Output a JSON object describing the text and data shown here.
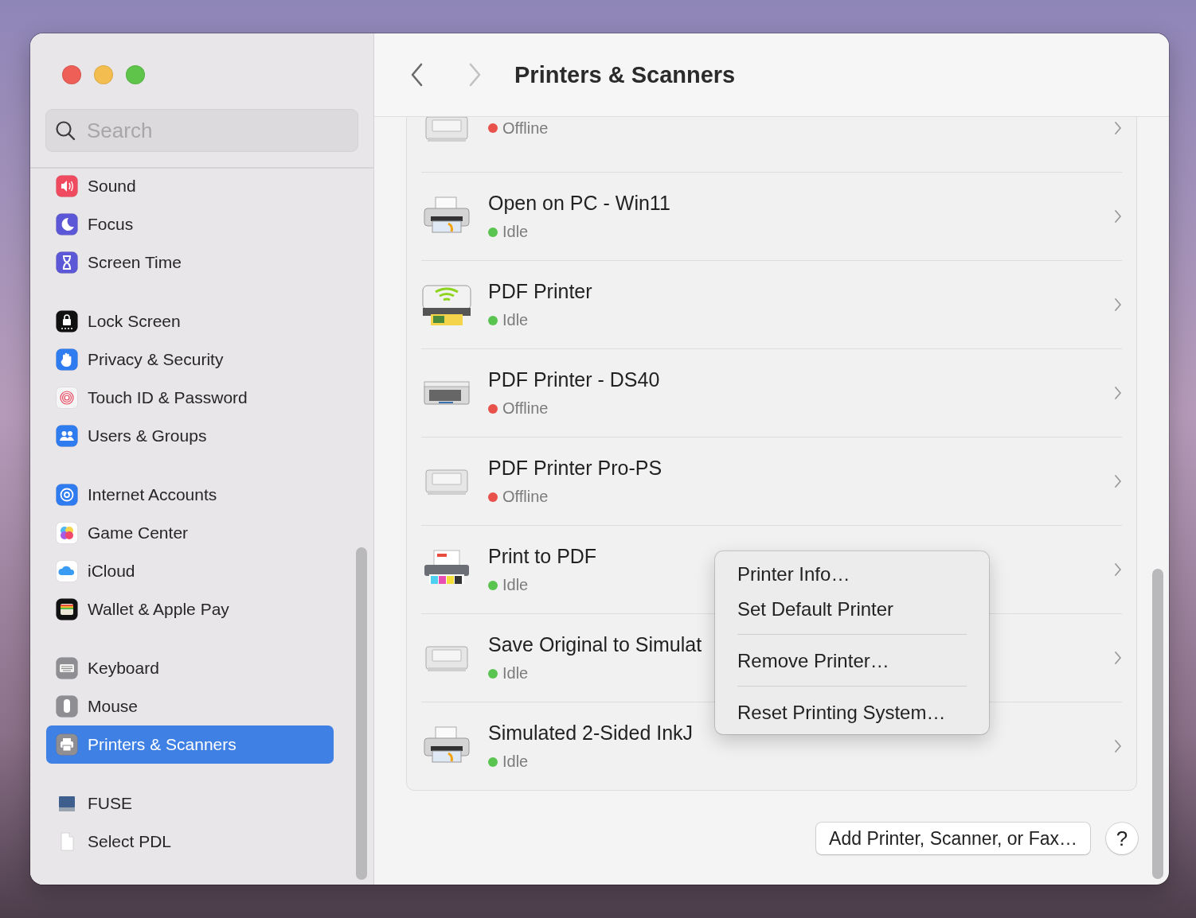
{
  "window": {
    "title": "Printers & Scanners"
  },
  "traffic_lights": [
    {
      "color": "#ed5f57"
    },
    {
      "color": "#f4bd4f"
    },
    {
      "color": "#5ec54a"
    }
  ],
  "search": {
    "placeholder": "Search"
  },
  "sidebar": {
    "groups": [
      [
        {
          "label": "Sound",
          "selected": false
        },
        {
          "label": "Focus",
          "selected": false
        },
        {
          "label": "Screen Time",
          "selected": false
        }
      ],
      [
        {
          "label": "Lock Screen",
          "selected": false
        },
        {
          "label": "Privacy & Security",
          "selected": false
        },
        {
          "label": "Touch ID & Password",
          "selected": false
        },
        {
          "label": "Users & Groups",
          "selected": false
        }
      ],
      [
        {
          "label": "Internet Accounts",
          "selected": false
        },
        {
          "label": "Game Center",
          "selected": false
        },
        {
          "label": "iCloud",
          "selected": false
        },
        {
          "label": "Wallet & Apple Pay",
          "selected": false
        }
      ],
      [
        {
          "label": "Keyboard",
          "selected": false
        },
        {
          "label": "Mouse",
          "selected": false
        },
        {
          "label": "Printers & Scanners",
          "selected": true
        }
      ],
      [
        {
          "label": "FUSE",
          "selected": false
        },
        {
          "label": "Select PDL",
          "selected": false
        }
      ]
    ]
  },
  "nav": {
    "back": {
      "disabled": false
    },
    "forward": {
      "disabled": true
    }
  },
  "printers": [
    {
      "status": "Offline",
      "color": "#e9524a"
    },
    {
      "name": "Open on PC - Win11",
      "status": "Idle",
      "color": "#5ac451"
    },
    {
      "name": "PDF Printer",
      "status": "Idle",
      "color": "#5ac451"
    },
    {
      "name": "PDF Printer - DS40",
      "status": "Offline",
      "color": "#e9524a"
    },
    {
      "name": "PDF Printer Pro-PS",
      "status": "Offline",
      "color": "#e9524a"
    },
    {
      "name": "Print to PDF",
      "status": "Idle",
      "color": "#5ac451"
    },
    {
      "name": "Save Original to Simulat",
      "status": "Idle",
      "color": "#5ac451"
    },
    {
      "name": "Simulated 2-Sided InkJ",
      "status": "Idle",
      "color": "#5ac451"
    }
  ],
  "context_menu": {
    "groups": [
      [
        "Printer Info…",
        "Set Default Printer"
      ],
      [
        "Remove Printer…"
      ],
      [
        "Reset Printing System…"
      ]
    ]
  },
  "add_button": "Add Printer, Scanner, or Fax…",
  "help_button": "?"
}
